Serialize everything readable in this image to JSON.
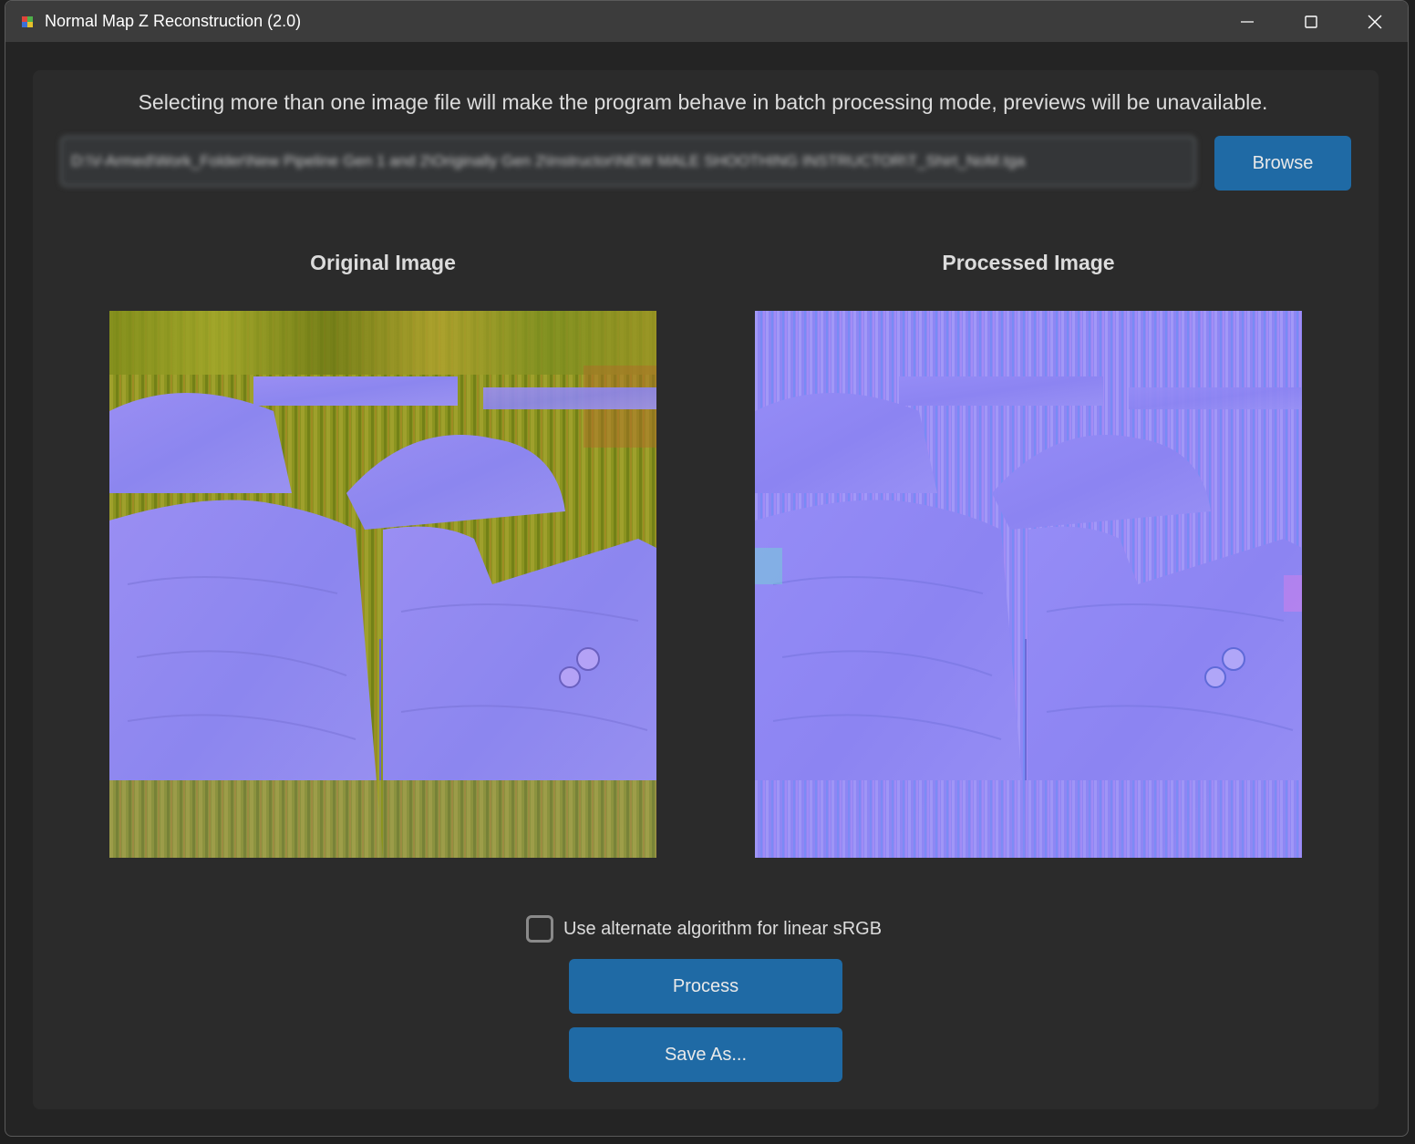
{
  "window": {
    "title": "Normal Map Z Reconstruction (2.0)",
    "icons": [
      "app-icon",
      "minimize-icon",
      "maximize-icon",
      "close-icon"
    ]
  },
  "main": {
    "info_text": "Selecting more than one image file will make the program behave in batch processing mode, previews will be unavailable.",
    "file_path": "D:\\V-Armed\\Work_Folder\\New Pipeline Gen 1 and 2\\Originally Gen 2\\Instructor\\NEW MALE SHOOTHING INSTRUCTOR\\T_Shirt_NoM.tga",
    "browse_label": "Browse",
    "original_title": "Original Image",
    "processed_title": "Processed Image",
    "alt_algorithm_label": "Use alternate algorithm for linear sRGB",
    "alt_algorithm_checked": false,
    "process_label": "Process",
    "save_label": "Save As..."
  },
  "colors": {
    "accent": "#1f6aa5",
    "panel": "#2b2b2b",
    "window_bg": "#242424",
    "titlebar": "#3c3c3c",
    "normal_map_blue": "#8f86f2",
    "original_yellow_green": "#8f9a1c"
  }
}
